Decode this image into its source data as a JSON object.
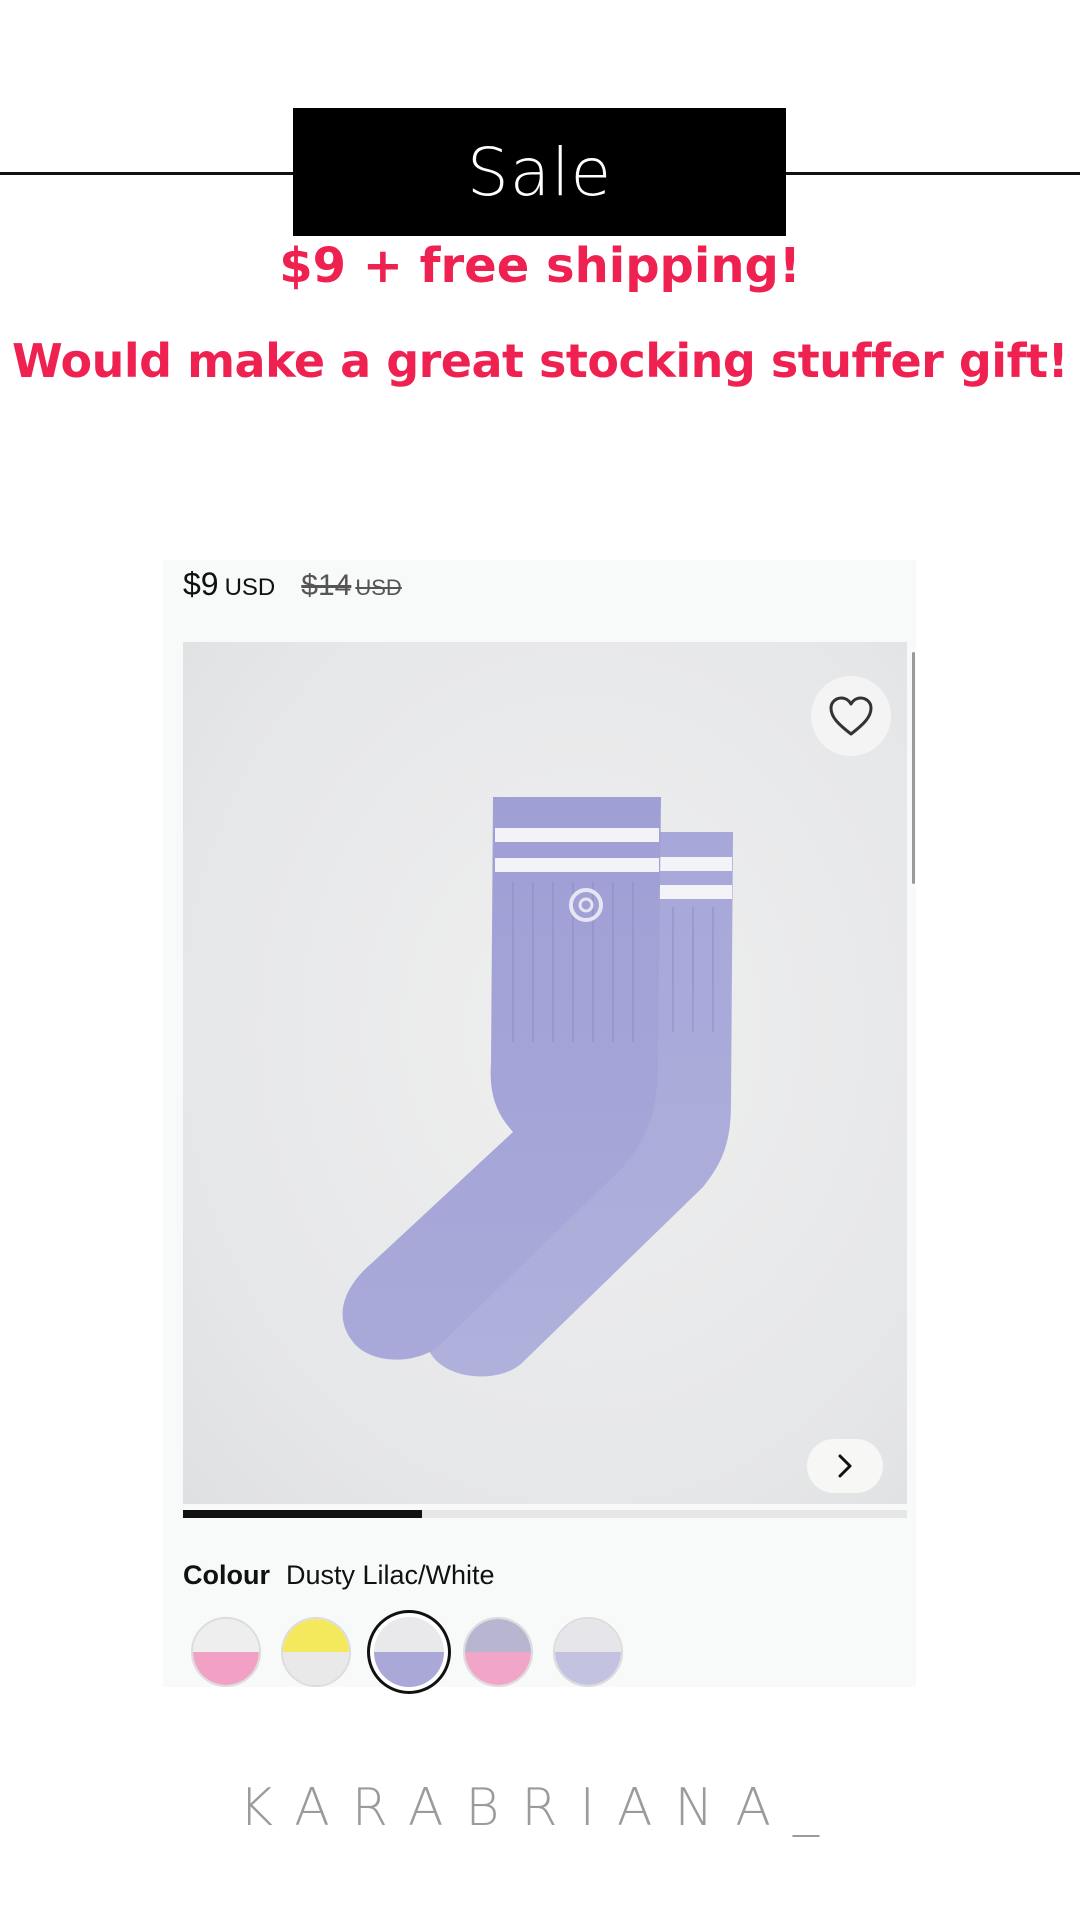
{
  "banner": {
    "title": "Sale"
  },
  "promo": {
    "line1": "$9 + free shipping!",
    "line2": "Would make a great stocking stuffer gift!",
    "color": "#ee2150"
  },
  "product": {
    "price": "$9",
    "price_currency": "USD",
    "original_price": "$14",
    "original_currency": "USD",
    "image_alt": "lilac-crew-socks-with-white-stripes",
    "gallery_progress": 0.33,
    "favorite_icon": "heart-outline-icon",
    "next_icon": "chevron-right-icon"
  },
  "colour": {
    "label": "Colour",
    "selected": "Dusty Lilac/White",
    "swatches": [
      {
        "name": "pink-white",
        "top": "#eeeeee",
        "bottom": "#f2a0c4"
      },
      {
        "name": "yellow-white",
        "top": "#f4e85c",
        "bottom": "#e9e9e9"
      },
      {
        "name": "dusty-lilac-white",
        "top": "#e9e9ec",
        "bottom": "#a9a8d6",
        "selected": true
      },
      {
        "name": "lilac-pink",
        "top": "#b7b5cf",
        "bottom": "#f1a6c8"
      },
      {
        "name": "lilac-grey",
        "top": "#e6e6ea",
        "bottom": "#c3c2e0"
      }
    ]
  },
  "footer": {
    "watermark": "KARABRIANA_"
  }
}
